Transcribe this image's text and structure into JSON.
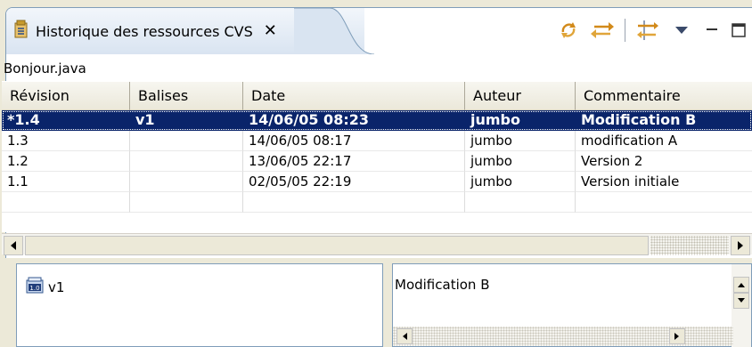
{
  "view": {
    "title": "Historique des ressources CVS",
    "close_label": "✕"
  },
  "toolbar": {
    "icons": [
      "refresh-icon",
      "link-with-editor-icon",
      "compare-icon",
      "view-menu-icon",
      "minimize-icon",
      "maximize-icon"
    ]
  },
  "file_label": "Bonjour.java",
  "table": {
    "columns": [
      "Révision",
      "Balises",
      "Date",
      "Auteur",
      "Commentaire"
    ],
    "rows": [
      {
        "revision": "*1.4",
        "tag": "v1",
        "date": "14/06/05 08:23",
        "author": "jumbo",
        "comment": "Modification B",
        "selected": true
      },
      {
        "revision": "1.3",
        "tag": "",
        "date": "14/06/05 08:17",
        "author": "jumbo",
        "comment": "modification A",
        "selected": false
      },
      {
        "revision": "1.2",
        "tag": "",
        "date": "13/06/05 22:17",
        "author": "jumbo",
        "comment": "Version 2",
        "selected": false
      },
      {
        "revision": "1.1",
        "tag": "",
        "date": "02/05/05 22:19",
        "author": "jumbo",
        "comment": "Version initiale",
        "selected": false
      }
    ]
  },
  "tags_pane": {
    "items": [
      {
        "label": "v1",
        "icon": "version-tag-icon",
        "icon_text": "1.0"
      }
    ]
  },
  "comment_pane": {
    "text": "Modification B"
  },
  "colors": {
    "selection": "#0a246a",
    "frame_border": "#7f9db9",
    "tab_gradient_top": "#f2f6fb",
    "tab_gradient_bottom": "#d9e4f1"
  }
}
